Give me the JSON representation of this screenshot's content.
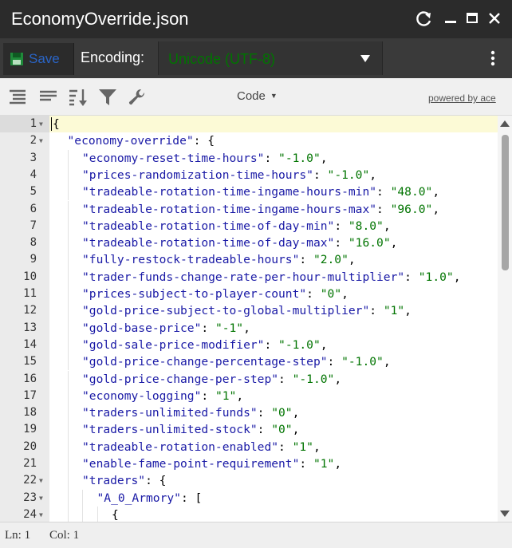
{
  "window": {
    "title": "EconomyOverride.json",
    "controls": [
      "refresh-icon",
      "minimize-icon",
      "maximize-icon",
      "close-icon"
    ]
  },
  "toolbar": {
    "save_label": "Save",
    "encoding_label": "Encoding:",
    "encoding_value": "Unicode (UTF-8)",
    "accent_color": "#2a64c5",
    "save_icon_color": "#1f8a3a"
  },
  "editor_toolbar": {
    "icons": [
      "format-icon",
      "compact-icon",
      "sort-icon",
      "filter-icon",
      "wrench-icon"
    ],
    "mode_label": "Code",
    "powered_by": "powered by ace"
  },
  "editor": {
    "active_line": 1,
    "lines": [
      {
        "n": "1",
        "fold": true,
        "indent": 0,
        "parts": [
          {
            "t": "{",
            "c": "p"
          }
        ]
      },
      {
        "n": "2",
        "fold": true,
        "indent": 1,
        "parts": [
          {
            "t": "\"economy-override\"",
            "c": "key"
          },
          {
            "t": ": {",
            "c": "p"
          }
        ]
      },
      {
        "n": "3",
        "fold": false,
        "indent": 2,
        "parts": [
          {
            "t": "\"economy-reset-time-hours\"",
            "c": "key"
          },
          {
            "t": ": ",
            "c": "p"
          },
          {
            "t": "\"-1.0\"",
            "c": "val"
          },
          {
            "t": ",",
            "c": "p"
          }
        ]
      },
      {
        "n": "4",
        "fold": false,
        "indent": 2,
        "parts": [
          {
            "t": "\"prices-randomization-time-hours\"",
            "c": "key"
          },
          {
            "t": ": ",
            "c": "p"
          },
          {
            "t": "\"-1.0\"",
            "c": "val"
          },
          {
            "t": ",",
            "c": "p"
          }
        ]
      },
      {
        "n": "5",
        "fold": false,
        "indent": 2,
        "parts": [
          {
            "t": "\"tradeable-rotation-time-ingame-hours-min\"",
            "c": "key"
          },
          {
            "t": ": ",
            "c": "p"
          },
          {
            "t": "\"48.0\"",
            "c": "val"
          },
          {
            "t": ",",
            "c": "p"
          }
        ]
      },
      {
        "n": "6",
        "fold": false,
        "indent": 2,
        "parts": [
          {
            "t": "\"tradeable-rotation-time-ingame-hours-max\"",
            "c": "key"
          },
          {
            "t": ": ",
            "c": "p"
          },
          {
            "t": "\"96.0\"",
            "c": "val"
          },
          {
            "t": ",",
            "c": "p"
          }
        ]
      },
      {
        "n": "7",
        "fold": false,
        "indent": 2,
        "parts": [
          {
            "t": "\"tradeable-rotation-time-of-day-min\"",
            "c": "key"
          },
          {
            "t": ": ",
            "c": "p"
          },
          {
            "t": "\"8.0\"",
            "c": "val"
          },
          {
            "t": ",",
            "c": "p"
          }
        ]
      },
      {
        "n": "8",
        "fold": false,
        "indent": 2,
        "parts": [
          {
            "t": "\"tradeable-rotation-time-of-day-max\"",
            "c": "key"
          },
          {
            "t": ": ",
            "c": "p"
          },
          {
            "t": "\"16.0\"",
            "c": "val"
          },
          {
            "t": ",",
            "c": "p"
          }
        ]
      },
      {
        "n": "9",
        "fold": false,
        "indent": 2,
        "parts": [
          {
            "t": "\"fully-restock-tradeable-hours\"",
            "c": "key"
          },
          {
            "t": ": ",
            "c": "p"
          },
          {
            "t": "\"2.0\"",
            "c": "val"
          },
          {
            "t": ",",
            "c": "p"
          }
        ]
      },
      {
        "n": "10",
        "fold": false,
        "indent": 2,
        "parts": [
          {
            "t": "\"trader-funds-change-rate-per-hour-multiplier\"",
            "c": "key"
          },
          {
            "t": ": ",
            "c": "p"
          },
          {
            "t": "\"1.0\"",
            "c": "val"
          },
          {
            "t": ",",
            "c": "p"
          }
        ]
      },
      {
        "n": "11",
        "fold": false,
        "indent": 2,
        "parts": [
          {
            "t": "\"prices-subject-to-player-count\"",
            "c": "key"
          },
          {
            "t": ": ",
            "c": "p"
          },
          {
            "t": "\"0\"",
            "c": "val"
          },
          {
            "t": ",",
            "c": "p"
          }
        ]
      },
      {
        "n": "12",
        "fold": false,
        "indent": 2,
        "parts": [
          {
            "t": "\"gold-price-subject-to-global-multiplier\"",
            "c": "key"
          },
          {
            "t": ": ",
            "c": "p"
          },
          {
            "t": "\"1\"",
            "c": "val"
          },
          {
            "t": ",",
            "c": "p"
          }
        ]
      },
      {
        "n": "13",
        "fold": false,
        "indent": 2,
        "parts": [
          {
            "t": "\"gold-base-price\"",
            "c": "key"
          },
          {
            "t": ": ",
            "c": "p"
          },
          {
            "t": "\"-1\"",
            "c": "val"
          },
          {
            "t": ",",
            "c": "p"
          }
        ]
      },
      {
        "n": "14",
        "fold": false,
        "indent": 2,
        "parts": [
          {
            "t": "\"gold-sale-price-modifier\"",
            "c": "key"
          },
          {
            "t": ": ",
            "c": "p"
          },
          {
            "t": "\"-1.0\"",
            "c": "val"
          },
          {
            "t": ",",
            "c": "p"
          }
        ]
      },
      {
        "n": "15",
        "fold": false,
        "indent": 2,
        "parts": [
          {
            "t": "\"gold-price-change-percentage-step\"",
            "c": "key"
          },
          {
            "t": ": ",
            "c": "p"
          },
          {
            "t": "\"-1.0\"",
            "c": "val"
          },
          {
            "t": ",",
            "c": "p"
          }
        ]
      },
      {
        "n": "16",
        "fold": false,
        "indent": 2,
        "parts": [
          {
            "t": "\"gold-price-change-per-step\"",
            "c": "key"
          },
          {
            "t": ": ",
            "c": "p"
          },
          {
            "t": "\"-1.0\"",
            "c": "val"
          },
          {
            "t": ",",
            "c": "p"
          }
        ]
      },
      {
        "n": "17",
        "fold": false,
        "indent": 2,
        "parts": [
          {
            "t": "\"economy-logging\"",
            "c": "key"
          },
          {
            "t": ": ",
            "c": "p"
          },
          {
            "t": "\"1\"",
            "c": "val"
          },
          {
            "t": ",",
            "c": "p"
          }
        ]
      },
      {
        "n": "18",
        "fold": false,
        "indent": 2,
        "parts": [
          {
            "t": "\"traders-unlimited-funds\"",
            "c": "key"
          },
          {
            "t": ": ",
            "c": "p"
          },
          {
            "t": "\"0\"",
            "c": "val"
          },
          {
            "t": ",",
            "c": "p"
          }
        ]
      },
      {
        "n": "19",
        "fold": false,
        "indent": 2,
        "parts": [
          {
            "t": "\"traders-unlimited-stock\"",
            "c": "key"
          },
          {
            "t": ": ",
            "c": "p"
          },
          {
            "t": "\"0\"",
            "c": "val"
          },
          {
            "t": ",",
            "c": "p"
          }
        ]
      },
      {
        "n": "20",
        "fold": false,
        "indent": 2,
        "parts": [
          {
            "t": "\"tradeable-rotation-enabled\"",
            "c": "key"
          },
          {
            "t": ": ",
            "c": "p"
          },
          {
            "t": "\"1\"",
            "c": "val"
          },
          {
            "t": ",",
            "c": "p"
          }
        ]
      },
      {
        "n": "21",
        "fold": false,
        "indent": 2,
        "parts": [
          {
            "t": "\"enable-fame-point-requirement\"",
            "c": "key"
          },
          {
            "t": ": ",
            "c": "p"
          },
          {
            "t": "\"1\"",
            "c": "val"
          },
          {
            "t": ",",
            "c": "p"
          }
        ]
      },
      {
        "n": "22",
        "fold": true,
        "indent": 2,
        "parts": [
          {
            "t": "\"traders\"",
            "c": "key"
          },
          {
            "t": ": {",
            "c": "p"
          }
        ]
      },
      {
        "n": "23",
        "fold": true,
        "indent": 3,
        "parts": [
          {
            "t": "\"A_0_Armory\"",
            "c": "key"
          },
          {
            "t": ": [",
            "c": "p"
          }
        ]
      },
      {
        "n": "24",
        "fold": true,
        "indent": 4,
        "parts": [
          {
            "t": "{",
            "c": "p"
          }
        ]
      }
    ]
  },
  "status": {
    "ln": "Ln: 1",
    "col": "Col: 1"
  }
}
